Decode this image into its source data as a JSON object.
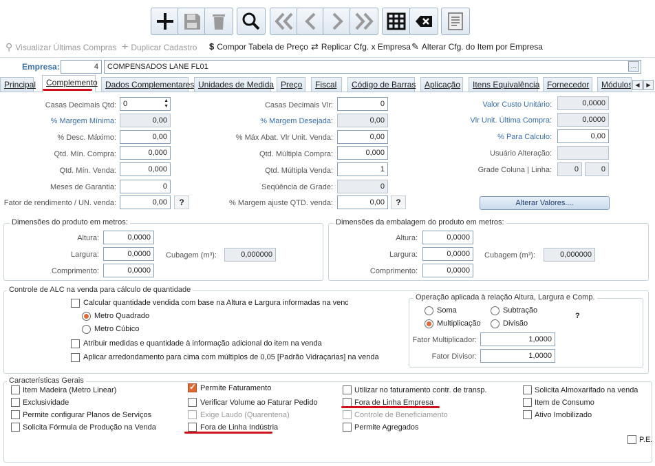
{
  "toolbar": {
    "buttons": [
      "add",
      "save",
      "delete",
      "search",
      "first",
      "prev",
      "next",
      "last",
      "grid",
      "clear",
      "report"
    ]
  },
  "actions": {
    "view_last_purchases": "Visualizar Últimas Compras",
    "duplicate": "Duplicar Cadastro",
    "price_table": "Compor Tabela de Preço",
    "replicate": "Replicar Cfg. x Empresa",
    "alter_cfg": "Alterar Cfg. do Item por  Empresa"
  },
  "company": {
    "label": "Empresa:",
    "code": "4",
    "name": "COMPENSADOS LANE FL01"
  },
  "tabs": [
    "Principal",
    "Complemento",
    "Dados Complementares",
    "Unidades de Medida",
    "Preço",
    "Fiscal",
    "Código de Barras",
    "Aplicação",
    "Itens Equivalência",
    "Fornecedor",
    "Módulos"
  ],
  "col1": {
    "casas_qtd": {
      "label": "Casas Decimais Qtd:",
      "value": "0"
    },
    "margem_min": {
      "label": "% Margem Mínima:",
      "value": "0,00"
    },
    "desc_max": {
      "label": "% Desc. Máximo:",
      "value": "0,00"
    },
    "qtd_min_compra": {
      "label": "Qtd. Mín. Compra:",
      "value": "0,000"
    },
    "qtd_min_venda": {
      "label": "Qtd. Mín. Venda:",
      "value": "0,000"
    },
    "meses_garantia": {
      "label": "Meses de Garantia:",
      "value": "0"
    },
    "fator_rend": {
      "label": "Fator de rendimento / UN. venda:",
      "value": "0,00"
    }
  },
  "col2": {
    "casas_vlr": {
      "label": "Casas Decimais Vlr:",
      "value": "0"
    },
    "margem_desejada": {
      "label": "% Margem Desejada:",
      "value": "0,00"
    },
    "max_abat": {
      "label": "% Máx Abat. Vlr Unit. Venda:",
      "value": "0,00"
    },
    "qtd_mult_compra": {
      "label": "Qtd. Múltipla Compra:",
      "value": "0,000"
    },
    "qtd_mult_venda": {
      "label": "Qtd. Múltipla Venda:",
      "value": "1"
    },
    "seq_grade": {
      "label": "Seqüência de Grade:",
      "value": "0"
    },
    "margem_ajuste": {
      "label": "% Margem ajuste QTD. venda:",
      "value": "0,00"
    }
  },
  "col3": {
    "valor_custo": {
      "label": "Valor Custo Unitário:",
      "value": "0,0000"
    },
    "vlr_ult_compra": {
      "label": "Vlr Unit. Última Compra:",
      "value": "0,0000"
    },
    "para_calculo": {
      "label": "% Para Calculo:",
      "value": "0,00"
    },
    "usuario_alt": {
      "label": "Usuário Alteração:",
      "value": ""
    },
    "grade": {
      "label": "Grade Coluna | Linha:",
      "col": "0",
      "lin": "0"
    },
    "alterar_btn": "Alterar Valores...."
  },
  "help_q": "?",
  "dim_prod": {
    "title": "Dimensões do produto em metros:",
    "altura_l": "Altura:",
    "altura": "0,0000",
    "largura_l": "Largura:",
    "largura": "0,0000",
    "comp_l": "Comprimento:",
    "comp": "0,0000",
    "cub_l": "Cubagem (m³):",
    "cub": "0,000000"
  },
  "dim_emb": {
    "title": "Dimensões da embalagem do produto em metros:",
    "altura_l": "Altura:",
    "altura": "0,0000",
    "largura_l": "Largura:",
    "largura": "0,0000",
    "comp_l": "Comprimento:",
    "comp": "0,0000",
    "cub_l": "Cubagem (m³):",
    "cub": "0,000000"
  },
  "alc": {
    "title": "Controle de ALC na venda para cálculo de quantidade",
    "calc": "Calcular quantidade vendida com base na Altura e Largura informadas na venda",
    "m2": "Metro Quadrado",
    "m3": "Metro Cúbico",
    "atribuir": "Atribuir medidas e quantidade à informação adicional do item na venda",
    "aplicar": "Aplicar arredondamento para cima com múltiplos de 0,05 [Padrão Vidraçarias] na venda",
    "op_title": "Operação aplicada à relação Altura, Largura e Comp.",
    "soma": "Soma",
    "subtracao": "Subtração",
    "mult": "Multiplicação",
    "div": "Divisão",
    "q": "?",
    "fmult_l": "Fator Multiplicador:",
    "fmult": "1,0000",
    "fdiv_l": "Fator Divisor:",
    "fdiv": "1,0000"
  },
  "gerais": {
    "title": "Características Gerais",
    "items": [
      "Item Madeira (Metro Linear)",
      "Exclusividade",
      "Permite configurar Planos de Serviços",
      "Solicita Fórmula de Produção na Venda",
      "Permite Faturamento",
      "Verificar Volume ao Faturar Pedido",
      "Exige Laudo (Quarentena)",
      "Fora de Linha Indústria",
      "Utilizar no faturamento contr. de transp.",
      "Fora de Linha Empresa",
      "Controle de Beneficiamento",
      "Permite Agregados",
      "Solicita Almoxarifado na venda",
      "Item de Consumo",
      "Ativo Imobilizado",
      "P.E."
    ]
  },
  "colors": {
    "accent": "#e06a35",
    "label_blue": "#3a6ea5",
    "annotation": "#d0101a"
  }
}
